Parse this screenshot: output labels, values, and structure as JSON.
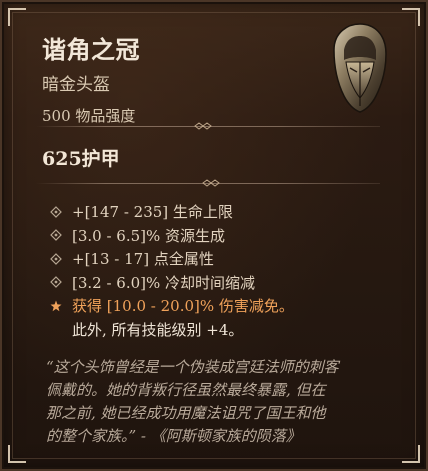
{
  "item": {
    "name": "谐角之冠",
    "type": "暗金头盔",
    "power": "500 物品强度"
  },
  "armor": "625护甲",
  "stats": [
    {
      "text": "+[147 - 235] 生命上限"
    },
    {
      "text": "[3.0 - 6.5]% 资源生成"
    },
    {
      "text": "+[13 - 17] 点全属性"
    },
    {
      "text": "[3.2 - 6.0]% 冷却时间缩减"
    }
  ],
  "legendary": {
    "text": "获得 [10.0 - 20.0]% 伤害减免。",
    "subtext": "此外, 所有技能级别 +4。"
  },
  "flavor": {
    "line1": "“这个头饰曾经是一个伪装成宫廷法师的刺客",
    "line2": "佩戴的。她的背叛行径虽然最终暴露, 但在",
    "line3": "那之前, 她已经成功用魔法诅咒了国王和他",
    "line4": "的整个家族。” - 《阿斯顿家族的陨落》"
  },
  "colors": {
    "legendary_orange": "#f0a25a",
    "stat_text": "#e2d3bf",
    "flavor_text": "#b9aa9a",
    "background": "#2b1b12"
  },
  "icons": {
    "item_image": "helmet-icon",
    "stat_bullet": "diamond-bullet-icon",
    "legendary_bullet": "star-icon"
  }
}
